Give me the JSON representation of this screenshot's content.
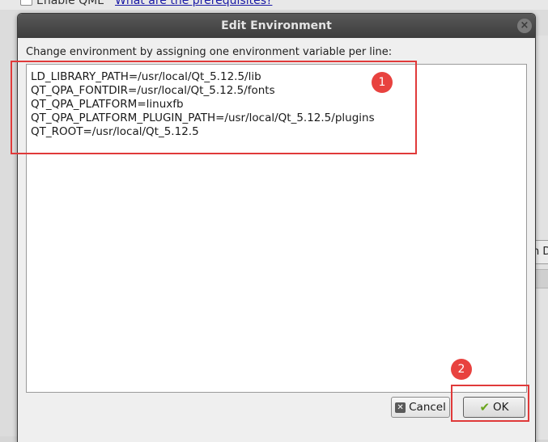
{
  "background": {
    "checkbox_label": "Enable QML",
    "link_text": "What are the prerequisites?",
    "right_button_partial": "n D"
  },
  "dialog": {
    "title": "Edit Environment",
    "close_glyph": "×",
    "instruction": "Change environment by assigning one environment variable per line:",
    "environment_lines": [
      "LD_LIBRARY_PATH=/usr/local/Qt_5.12.5/lib",
      "QT_QPA_FONTDIR=/usr/local/Qt_5.12.5/fonts",
      "QT_QPA_PLATFORM=linuxfb",
      "QT_QPA_PLATFORM_PLUGIN_PATH=/usr/local/Qt_5.12.5/plugins",
      "QT_ROOT=/usr/local/Qt_5.12.5"
    ],
    "buttons": {
      "cancel_label": "Cancel",
      "cancel_icon": "cancel-x-icon",
      "ok_label": "OK",
      "ok_icon": "checkmark-icon"
    }
  },
  "annotations": {
    "badge_1": "1",
    "badge_2": "2",
    "color": "#e03a3a"
  }
}
